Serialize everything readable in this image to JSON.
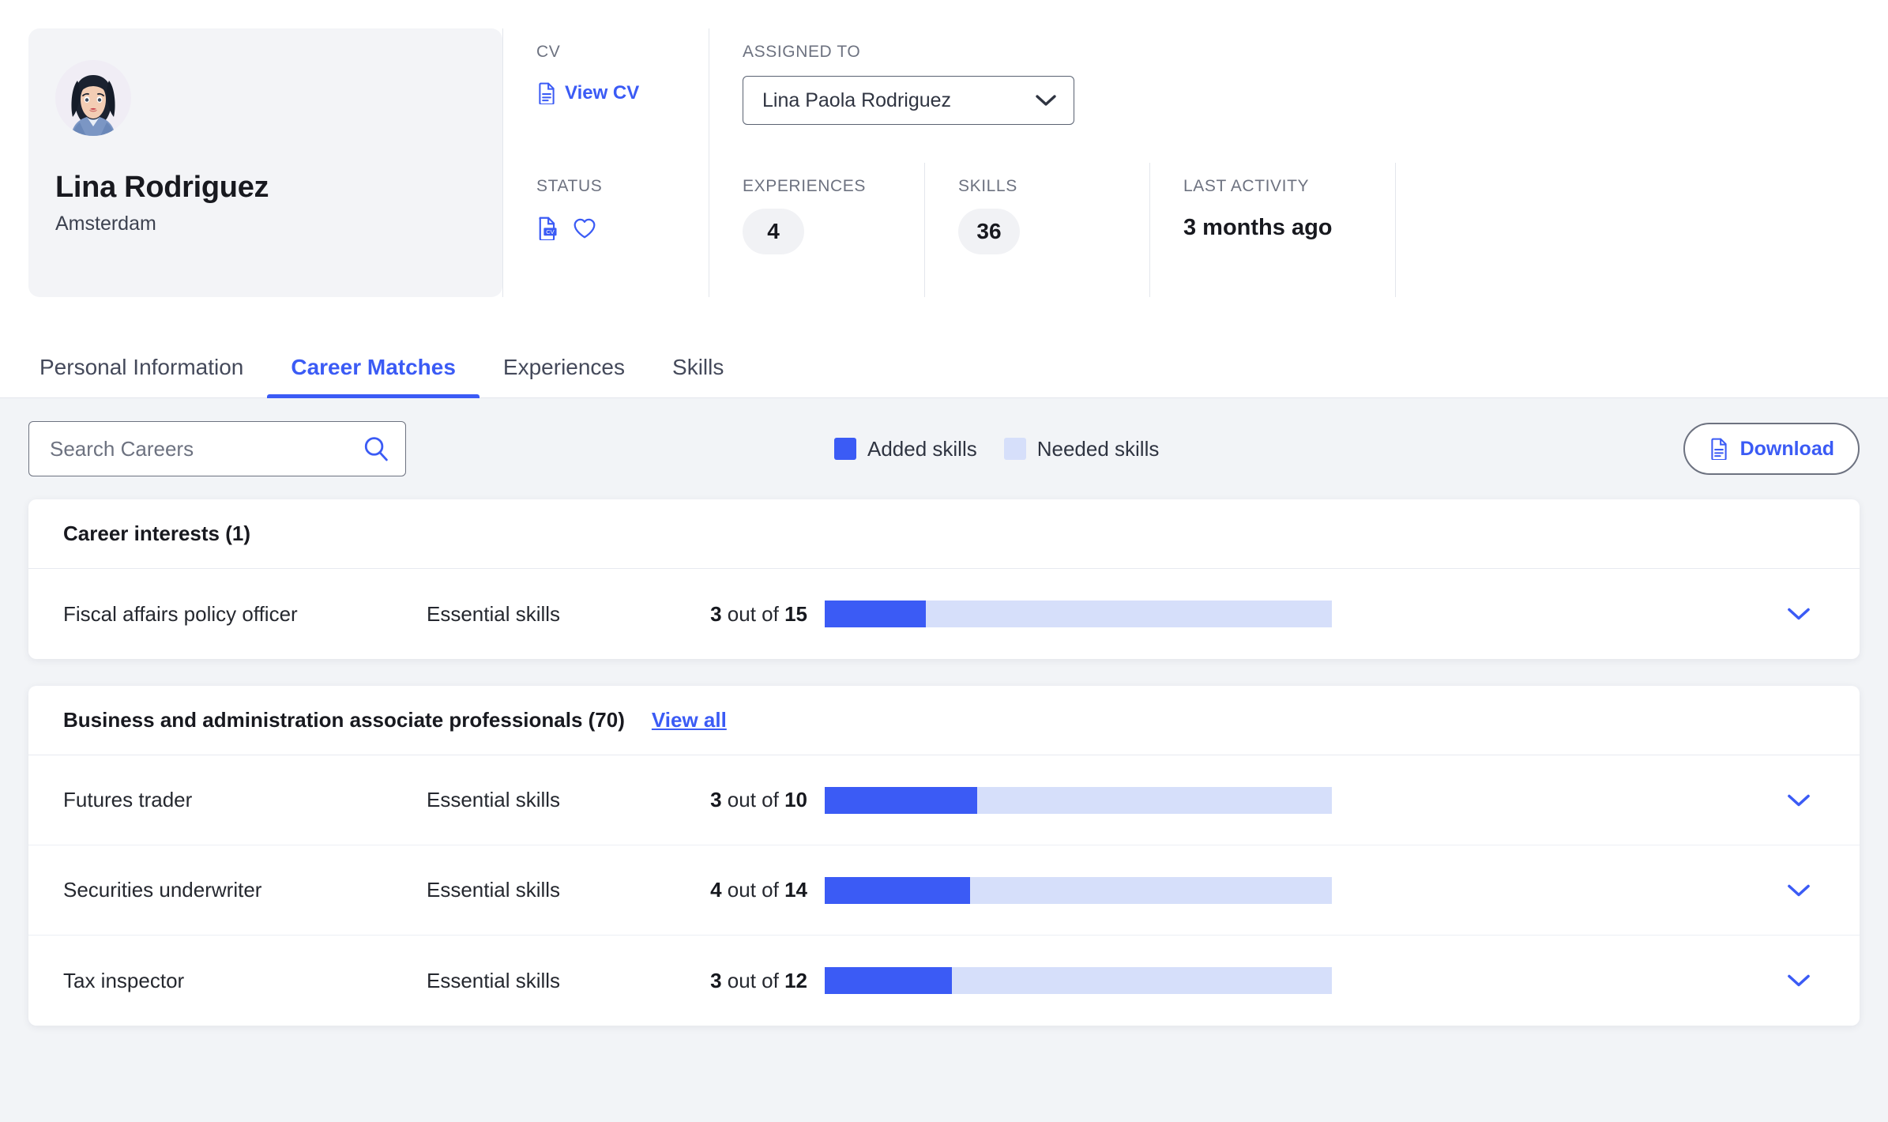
{
  "profile": {
    "name": "Lina Rodriguez",
    "city": "Amsterdam",
    "avatar_icon": "avatar-woman-illustration"
  },
  "meta": {
    "cv_label": "CV",
    "cv_link": "View CV",
    "cv_icon": "document-icon",
    "assigned_label": "ASSIGNED TO",
    "assigned_value": "Lina Paola Rodriguez",
    "assigned_chevron_icon": "chevron-down-icon",
    "status_label": "STATUS",
    "status_cv_icon": "cv-document-icon",
    "status_favorite_icon": "heart-icon",
    "experiences_label": "EXPERIENCES",
    "experiences_value": "4",
    "skills_label": "SKILLS",
    "skills_value": "36",
    "last_activity_label": "LAST ACTIVITY",
    "last_activity_value": "3 months ago"
  },
  "tabs": [
    {
      "label": "Personal Information",
      "active": false
    },
    {
      "label": "Career Matches",
      "active": true
    },
    {
      "label": "Experiences",
      "active": false
    },
    {
      "label": "Skills",
      "active": false
    }
  ],
  "toolbar": {
    "search_placeholder": "Search Careers",
    "search_value": "",
    "search_icon": "search-icon",
    "download_label": "Download",
    "download_icon": "document-icon",
    "legend": [
      {
        "label": "Added skills",
        "color": "#3b5bf5",
        "icon": "legend-swatch-added"
      },
      {
        "label": "Needed skills",
        "color": "#d6dffa",
        "icon": "legend-swatch-needed"
      }
    ]
  },
  "colors": {
    "accent": "#3b5bf5",
    "bar_track": "#d6dffa",
    "page_bg": "#f2f4f7",
    "card_bg": "#ffffff"
  },
  "sections": [
    {
      "title": "Career interests (1)",
      "view_all": null,
      "rows": [
        {
          "title": "Fiscal affairs policy officer",
          "subtitle": "Essential skills",
          "have": "3",
          "out_of_word": " out of ",
          "total": "15",
          "percent": 20,
          "chevron_icon": "chevron-down-icon"
        }
      ]
    },
    {
      "title": "Business and administration associate professionals (70)",
      "view_all": "View all",
      "rows": [
        {
          "title": "Futures trader",
          "subtitle": "Essential skills",
          "have": "3",
          "out_of_word": " out of ",
          "total": "10",
          "percent": 30,
          "chevron_icon": "chevron-down-icon"
        },
        {
          "title": "Securities underwriter",
          "subtitle": "Essential skills",
          "have": "4",
          "out_of_word": " out of ",
          "total": "14",
          "percent": 28.6,
          "chevron_icon": "chevron-down-icon"
        },
        {
          "title": "Tax inspector",
          "subtitle": "Essential skills",
          "have": "3",
          "out_of_word": " out of ",
          "total": "12",
          "percent": 25,
          "chevron_icon": "chevron-down-icon"
        }
      ]
    }
  ]
}
